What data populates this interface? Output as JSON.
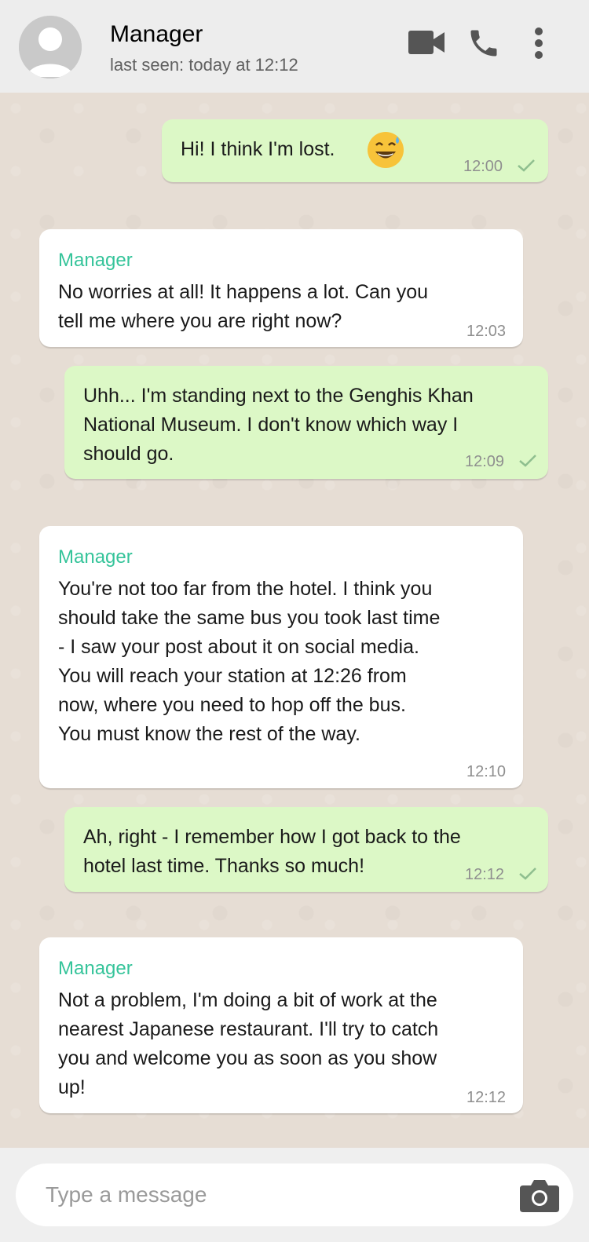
{
  "header": {
    "contact_name": "Manager",
    "last_seen": "last seen: today at 12:12",
    "icons": [
      "avatar",
      "video-icon",
      "phone-icon",
      "more-icon"
    ]
  },
  "messages": [
    {
      "direction": "outgoing",
      "text": "Hi! I think I'm lost.",
      "emoji": "sweat-smile-emoji",
      "time": "12:00",
      "status": "sent-check"
    },
    {
      "direction": "incoming",
      "sender": "Manager",
      "text": "No worries at all! It happens a lot. Can you\ntell me where you are right now?",
      "time": "12:03"
    },
    {
      "direction": "outgoing",
      "text": "Uhh... I'm standing next to the Genghis Khan\nNational Museum. I don't know which way I\nshould go.",
      "time": "12:09",
      "status": "sent-check"
    },
    {
      "direction": "incoming",
      "sender": "Manager",
      "text": "You're not too far from the hotel. I think you\nshould take the same bus you took last time\n- I saw your post about it on social media.\nYou will reach your station at 12:26 from\nnow, where you need to hop off the bus.\nYou must know the rest of the way.",
      "time": "12:10"
    },
    {
      "direction": "outgoing",
      "text": "Ah, right - I remember how I got back to the\nhotel last time. Thanks so much!",
      "time": "12:12",
      "status": "sent-check"
    },
    {
      "direction": "incoming",
      "sender": "Manager",
      "text": "Not a problem, I'm doing a bit of work at the\nnearest Japanese restaurant. I'll try to catch\nyou and welcome you as soon as you show\nup!",
      "time": "12:12"
    }
  ],
  "composer": {
    "placeholder": "Type a message",
    "icon": "camera-icon"
  },
  "colors": {
    "outgoing_bubble": "#dcf8c6",
    "incoming_bubble": "#ffffff",
    "sender_name": "#35c49a",
    "chat_background": "#e6ddd4",
    "header_background": "#ededed"
  }
}
